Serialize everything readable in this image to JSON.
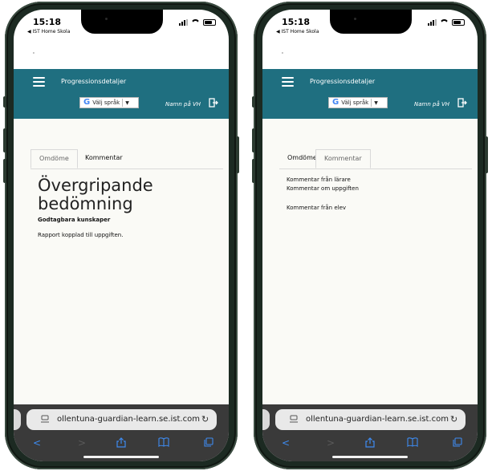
{
  "phones": [
    {
      "status": {
        "time": "15:18",
        "back_app": "IST Home Skola"
      },
      "header": {
        "title": "Progressionsdetaljer",
        "language": "Välj språk",
        "user": "Namn på VH"
      },
      "tabs": [
        {
          "label": "Omdöme"
        },
        {
          "label": "Kommentar"
        }
      ],
      "active_tab": "Omdöme",
      "content": {
        "heading_line1": "Övergripande",
        "heading_line2": "bedömning",
        "grade": "Godtagbara kunskaper",
        "report": "Rapport kopplad till uppgiften."
      },
      "browser": {
        "url": "ollentuna-guardian-learn.se.ist.com"
      }
    },
    {
      "status": {
        "time": "15:18",
        "back_app": "IST Home Skola"
      },
      "header": {
        "title": "Progressionsdetaljer",
        "language": "Välj språk",
        "user": "Namn på VH"
      },
      "tabs": [
        {
          "label": "Omdöme"
        },
        {
          "label": "Kommentar"
        }
      ],
      "active_tab": "Kommentar",
      "content": {
        "teacher_comment": "Kommentar från lärare",
        "task_comment": "Kommentar om uppgiften",
        "student_comment": "Kommentar från elev"
      },
      "browser": {
        "url": "ollentuna-guardian-learn.se.ist.com"
      }
    }
  ],
  "colors": {
    "header": "#1f6f80",
    "accent": "#3e8bf0",
    "toolbar": "#3a3a3a"
  },
  "icons": [
    "menu-icon",
    "google-g-icon",
    "logout-icon",
    "page-icon",
    "reload-icon",
    "back-icon",
    "forward-icon",
    "share-icon",
    "bookmarks-icon",
    "tabs-icon"
  ]
}
